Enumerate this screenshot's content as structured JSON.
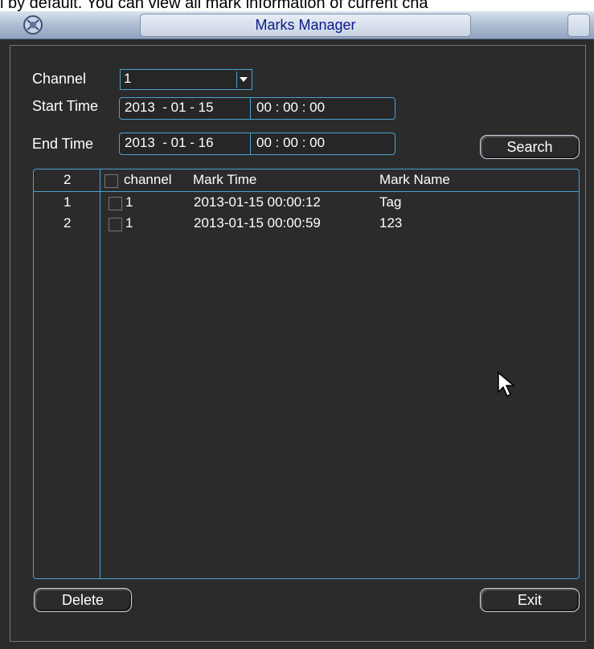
{
  "doc_text": "l by default. You can view all mark information of current cha",
  "window": {
    "title": "Marks Manager"
  },
  "filters": {
    "channel_label": "Channel",
    "channel_value": "1",
    "start_label": "Start Time",
    "start_date": "2013  - 01 - 15",
    "start_time": "00 : 00 : 00",
    "end_label": "End Time",
    "end_date": "2013  - 01 - 16",
    "end_time": "00 : 00 : 00"
  },
  "buttons": {
    "search": "Search",
    "delete": "Delete",
    "exit": "Exit"
  },
  "table": {
    "count": "2",
    "headers": {
      "channel": "channel",
      "time": "Mark Time",
      "name": "Mark Name"
    },
    "rows": [
      {
        "index": "1",
        "channel": "1",
        "time": "2013-01-15 00:00:12",
        "name": "Tag"
      },
      {
        "index": "2",
        "channel": "1",
        "time": "2013-01-15 00:00:59",
        "name": "123"
      }
    ]
  },
  "colors": {
    "accent": "#4aa3d0",
    "background": "#2b2b2b",
    "title_text": "#0a1a8a"
  },
  "icons": {
    "logo": "app-logo-icon",
    "cursor": "mouse-pointer-icon",
    "dropdown": "dropdown-arrow-icon"
  }
}
